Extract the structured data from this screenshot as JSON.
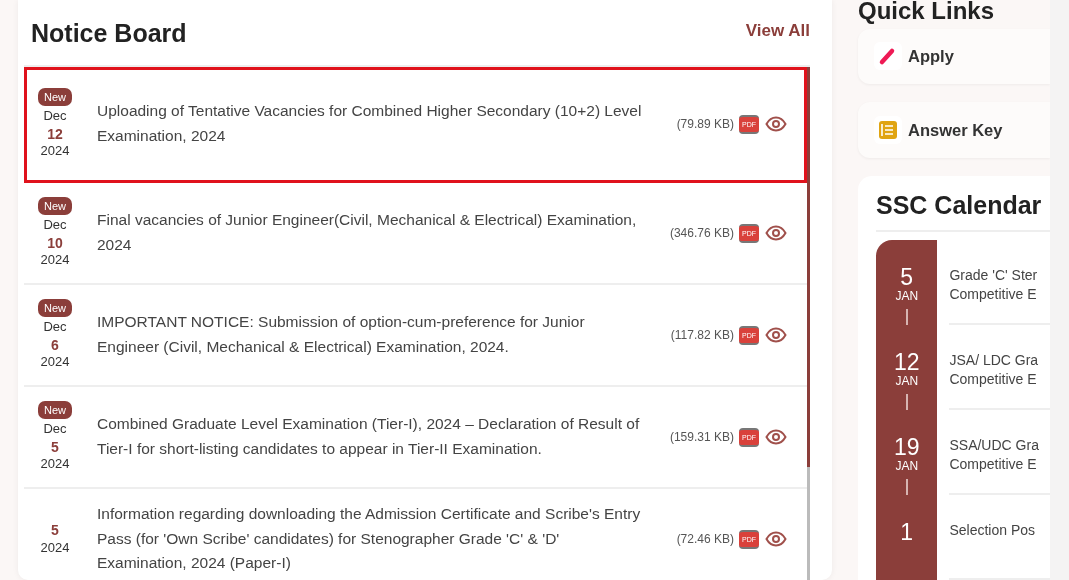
{
  "notice_board": {
    "title": "Notice Board",
    "view_all": "View All",
    "notices": [
      {
        "badge": "New",
        "month": "Dec",
        "day": "12",
        "year": "2024",
        "title": "Uploading of Tentative Vacancies for Combined Higher Secondary (10+2) Level Examination, 2024",
        "size": "(79.89 KB)",
        "file_type": "PDF",
        "highlighted": true
      },
      {
        "badge": "New",
        "month": "Dec",
        "day": "10",
        "year": "2024",
        "title": "Final vacancies of Junior Engineer(Civil, Mechanical & Electrical) Examination, 2024",
        "size": "(346.76 KB)",
        "file_type": "PDF",
        "highlighted": false
      },
      {
        "badge": "New",
        "month": "Dec",
        "day": "6",
        "year": "2024",
        "title": "IMPORTANT NOTICE: Submission of option-cum-preference for Junior Engineer (Civil, Mechanical & Electrical) Examination, 2024.",
        "size": "(117.82 KB)",
        "file_type": "PDF",
        "highlighted": false
      },
      {
        "badge": "New",
        "month": "Dec",
        "day": "5",
        "year": "2024",
        "title": "Combined Graduate Level Examination (Tier-I), 2024 – Declaration of Result of Tier-I for short-listing candidates to appear in Tier-II Examination.",
        "size": "(159.31 KB)",
        "file_type": "PDF",
        "highlighted": false
      },
      {
        "day": "5",
        "year": "2024",
        "title": "Information regarding downloading the Admission Certificate and Scribe's Entry Pass (for 'Own Scribe' candidates) for Stenographer Grade 'C' & 'D' Examination, 2024 (Paper-I)",
        "size": "(72.46 KB)",
        "file_type": "PDF",
        "highlighted": false
      }
    ]
  },
  "quick_links": {
    "title": "Quick Links",
    "links": [
      {
        "label": "Apply",
        "kind": "pencil"
      },
      {
        "label": "Answer Key",
        "kind": "list"
      }
    ]
  },
  "calendar": {
    "title": "SSC Calendar",
    "events": [
      {
        "day": "5",
        "month": "JAN",
        "lines": [
          "Grade 'C' Ster",
          "Competitive E"
        ]
      },
      {
        "day": "12",
        "month": "JAN",
        "lines": [
          "JSA/ LDC Gra",
          "Competitive E"
        ]
      },
      {
        "day": "19",
        "month": "JAN",
        "lines": [
          "SSA/UDC Gra",
          "Competitive E"
        ]
      },
      {
        "day": "1",
        "lines": [
          "Selection Pos"
        ]
      }
    ]
  }
}
